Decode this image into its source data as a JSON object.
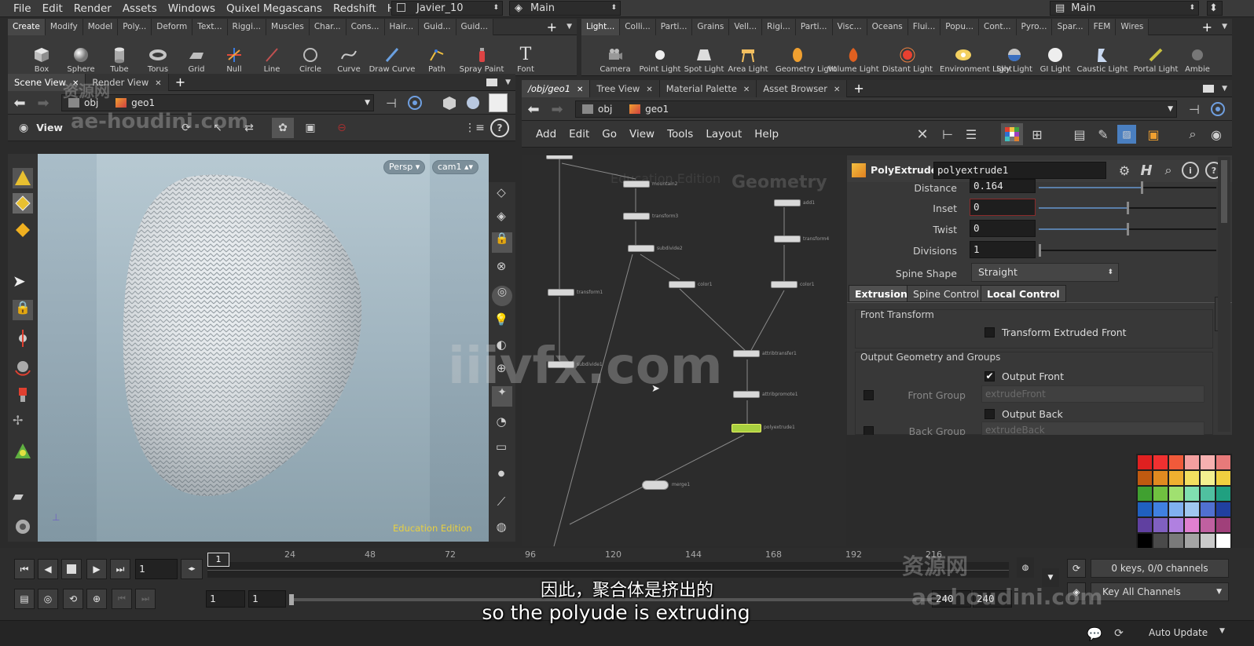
{
  "menubar": {
    "items": [
      "File",
      "Edit",
      "Render",
      "Assets",
      "Windows",
      "Quixel Megascans",
      "Redshift",
      "Help"
    ],
    "scene_file": "Javier_10",
    "desktop": "Main",
    "right_combo": "Main"
  },
  "shelf_left": {
    "tabs": [
      "Create",
      "Modify",
      "Model",
      "Poly...",
      "Deform",
      "Text...",
      "Riggi...",
      "Muscles",
      "Char...",
      "Cons...",
      "Hair...",
      "Guid...",
      "Guid..."
    ],
    "tools": [
      "Box",
      "Sphere",
      "Tube",
      "Torus",
      "Grid",
      "Null",
      "Line",
      "Circle",
      "Curve",
      "Draw Curve",
      "Path",
      "Spray Paint",
      "Font"
    ]
  },
  "shelf_right": {
    "tabs": [
      "Light...",
      "Colli...",
      "Parti...",
      "Grains",
      "Vell...",
      "Rigi...",
      "Parti...",
      "Visc...",
      "Oceans",
      "Flui...",
      "Popu...",
      "Cont...",
      "Pyro...",
      "Spar...",
      "FEM",
      "Wires"
    ],
    "tools": [
      "Camera",
      "Point Light",
      "Spot Light",
      "Area Light",
      "Geometry Light",
      "Volume Light",
      "Distant Light",
      "Environment Light",
      "Sky Light",
      "GI Light",
      "Caustic Light",
      "Portal Light",
      "Ambie"
    ]
  },
  "left_pane": {
    "tabs": [
      "Scene View",
      "Render View"
    ],
    "path": [
      "obj",
      "geo1"
    ],
    "view_label": "View",
    "camera": "Persp",
    "cam_name": "cam1",
    "edition": "Education Edition"
  },
  "right_pane": {
    "tabs": [
      "/obj/geo1",
      "Tree View",
      "Material Palette",
      "Asset Browser"
    ],
    "path": [
      "obj",
      "geo1"
    ],
    "menu": [
      "Add",
      "Edit",
      "Go",
      "View",
      "Tools",
      "Layout",
      "Help"
    ],
    "network_watermark": "Geometry",
    "network_edition": "Education Edition"
  },
  "network_nodes": [
    {
      "label": "mountain2"
    },
    {
      "label": "transform3"
    },
    {
      "label": "subdivide2"
    },
    {
      "label": "add1"
    },
    {
      "label": "transform4"
    },
    {
      "label": "transform1"
    },
    {
      "label": "color1"
    },
    {
      "label": "color1"
    },
    {
      "label": "subdivide1"
    },
    {
      "label": "attribtransfer1"
    },
    {
      "label": "attribpromote1"
    },
    {
      "label": "polyextrude1"
    },
    {
      "label": "merge1"
    }
  ],
  "params": {
    "node_type": "PolyExtrude",
    "node_name": "polyextrude1",
    "distance_label": "Distance",
    "distance_value": "0.164",
    "distance_fraction": 0.58,
    "inset_label": "Inset",
    "inset_value": "0",
    "inset_fraction": 0.5,
    "twist_label": "Twist",
    "twist_value": "0",
    "twist_fraction": 0.5,
    "divisions_label": "Divisions",
    "divisions_value": "1",
    "divisions_fraction": 0.0,
    "spine_label": "Spine Shape",
    "spine_value": "Straight",
    "tabs": [
      "Extrusion",
      "Spine Control",
      "Local Control"
    ],
    "front_transform_header": "Front Transform",
    "transform_extruded_front": "Transform Extruded Front",
    "output_header": "Output Geometry and Groups",
    "output_front": "Output Front",
    "front_group_label": "Front Group",
    "front_group_value": "extrudeFront",
    "output_back": "Output Back",
    "back_group_label": "Back Group",
    "back_group_value": "extrudeBack"
  },
  "timeline": {
    "current_frame": "1",
    "frame_marker": "1",
    "ticks": [
      "24",
      "48",
      "72",
      "96",
      "120",
      "144",
      "168",
      "192",
      "216"
    ],
    "range_start": "1",
    "range_start2": "1",
    "range_end": "240",
    "range_end2": "240",
    "keys_info": "0 keys, 0/0 channels",
    "key_all": "Key All Channels",
    "auto_update": "Auto Update"
  },
  "subtitles": {
    "zh": "因此，聚合体是挤出的",
    "en": "so the polyude is extruding"
  },
  "watermarks": {
    "site1_zh": "资源网",
    "site1": "ae-houdini.com",
    "site2": "iiivfx.com"
  },
  "palette_colors": [
    "#e02020",
    "#f03030",
    "#f05a3a",
    "#f3a0a0",
    "#f6b0b0",
    "#e77a7a",
    "#c05a10",
    "#e08a20",
    "#f0b030",
    "#f3e060",
    "#f3f090",
    "#f0d040",
    "#40a030",
    "#70c040",
    "#a0e070",
    "#80e0b0",
    "#50c0a0",
    "#20a080",
    "#2060c0",
    "#4080e0",
    "#80b0f0",
    "#a0c8f0",
    "#5070d0",
    "#2040a0",
    "#6040a0",
    "#8060c0",
    "#b080e0",
    "#e080d0",
    "#c060a0",
    "#a0407a",
    "#000000",
    "#4a4a4a",
    "#7a7a7a",
    "#a4a4a4",
    "#cacaca",
    "#ffffff"
  ]
}
